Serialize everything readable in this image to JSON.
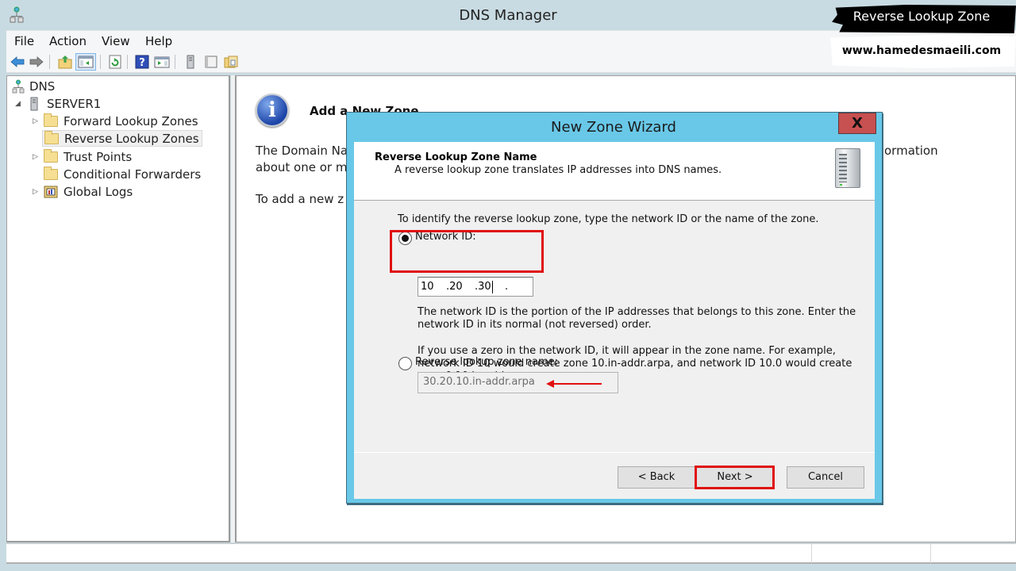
{
  "window": {
    "title": "DNS Manager",
    "app_icon": "dns-network-icon"
  },
  "menu": {
    "items": [
      "File",
      "Action",
      "View",
      "Help"
    ]
  },
  "toolbar": {
    "buttons": [
      {
        "name": "back-arrow-icon"
      },
      {
        "name": "forward-arrow-icon"
      },
      {
        "name": "up-folder-icon"
      },
      {
        "name": "show-hide-console-tree-icon"
      },
      {
        "name": "refresh-icon"
      },
      {
        "name": "help-icon"
      },
      {
        "name": "show-action-pane-icon"
      },
      {
        "name": "server-icon"
      },
      {
        "name": "blank-page-icon"
      },
      {
        "name": "folder-copy-icon"
      }
    ]
  },
  "tree": {
    "root": "DNS",
    "server": "SERVER1",
    "items": [
      {
        "label": "Forward Lookup Zones",
        "expandable": true,
        "selected": false
      },
      {
        "label": "Reverse Lookup Zones",
        "expandable": false,
        "selected": true
      },
      {
        "label": "Trust Points",
        "expandable": true,
        "selected": false
      },
      {
        "label": "Conditional Forwarders",
        "expandable": false,
        "selected": false
      },
      {
        "label": "Global Logs",
        "expandable": true,
        "selected": false
      }
    ]
  },
  "content": {
    "heading": "Add a New Zone",
    "line1_start": "The Domain Na",
    "line1_end": "ormation",
    "line2_start": "about one or m",
    "line3_start": "To add a new z"
  },
  "banner": {
    "title": "Reverse Lookup Zone",
    "website": "www.hamedesmaeili.com"
  },
  "dialog": {
    "title": "New Zone Wizard",
    "close_label": "X",
    "header_title": "Reverse Lookup Zone Name",
    "header_subtitle": "A reverse lookup zone translates IP addresses into DNS names.",
    "instruction": "To identify the reverse lookup zone, type the network ID or the name of the zone.",
    "option_network_id": {
      "label": "Network ID:",
      "checked": true,
      "octets": [
        "10",
        ".20",
        ".30",
        "."
      ]
    },
    "desc_1": "The network ID is the portion of the IP addresses that belongs to this zone. Enter the",
    "desc_2": "network ID in its normal (not reversed) order.",
    "desc_3": "If you use a zero in the network ID, it will appear in the zone name. For example,",
    "desc_4": "network ID 10 would create zone 10.in-addr.arpa, and network ID 10.0 would create",
    "desc_5": "zone 0.10.in-addr.arpa.",
    "option_zone_name": {
      "label": "Reverse lookup zone name:",
      "checked": false,
      "value": "30.20.10.in-addr.arpa"
    },
    "buttons": {
      "back": "< Back",
      "next": "Next >",
      "cancel": "Cancel"
    }
  },
  "colors": {
    "dialog_frame": "#69c8e8",
    "close_button": "#c75050",
    "highlight": "#e01010",
    "window_chrome": "#c9dbe2"
  }
}
